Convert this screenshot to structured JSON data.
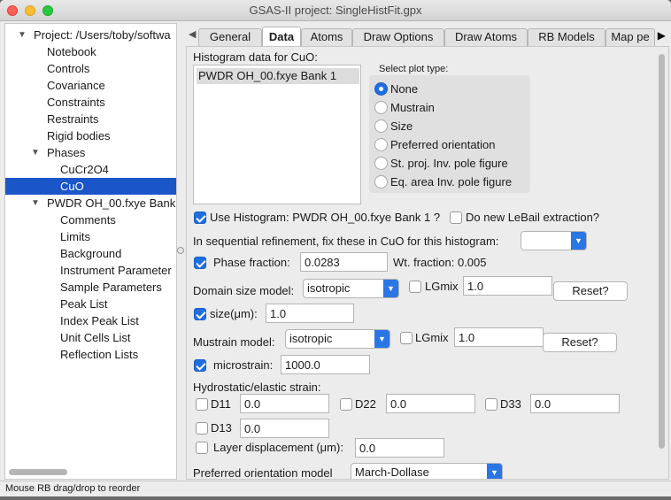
{
  "window": {
    "title": "GSAS-II project: SingleHistFit.gpx"
  },
  "tree": {
    "items": [
      {
        "label": "Project: /Users/toby/softwa",
        "level": 0,
        "arrow": "▼"
      },
      {
        "label": "Notebook",
        "level": 1
      },
      {
        "label": "Controls",
        "level": 1
      },
      {
        "label": "Covariance",
        "level": 1
      },
      {
        "label": "Constraints",
        "level": 1
      },
      {
        "label": "Restraints",
        "level": 1
      },
      {
        "label": "Rigid bodies",
        "level": 1
      },
      {
        "label": "Phases",
        "level": 1,
        "arrow": "▼"
      },
      {
        "label": "CuCr2O4",
        "level": 2
      },
      {
        "label": "CuO",
        "level": 2,
        "selected": true
      },
      {
        "label": "PWDR OH_00.fxye Bank",
        "level": 1,
        "arrow": "▼"
      },
      {
        "label": "Comments",
        "level": 2
      },
      {
        "label": "Limits",
        "level": 2
      },
      {
        "label": "Background",
        "level": 2
      },
      {
        "label": "Instrument Parameter",
        "level": 2
      },
      {
        "label": "Sample Parameters",
        "level": 2
      },
      {
        "label": "Peak List",
        "level": 2
      },
      {
        "label": "Index Peak List",
        "level": 2
      },
      {
        "label": "Unit Cells List",
        "level": 2
      },
      {
        "label": "Reflection Lists",
        "level": 2
      }
    ]
  },
  "tabs": {
    "items": [
      "General",
      "Data",
      "Atoms",
      "Draw Options",
      "Draw Atoms",
      "RB Models",
      "Map pe"
    ],
    "active": "Data"
  },
  "data_tab": {
    "histogram_header": "Histogram data for CuO:",
    "histogram_list": [
      "PWDR OH_00.fxye Bank 1"
    ],
    "plot_type_label": "Select plot type:",
    "plot_types": [
      "None",
      "Mustrain",
      "Size",
      "Preferred orientation",
      "St. proj. Inv. pole figure",
      "Eq. area Inv. pole figure"
    ],
    "plot_type_selected": "None",
    "use_histogram_label": "Use Histogram: PWDR OH_00.fxye Bank 1 ?",
    "use_histogram_checked": true,
    "lebail_label": "Do new LeBail extraction?",
    "lebail_checked": false,
    "seq_fix_label": "In sequential refinement, fix these in CuO for this histogram:",
    "seq_fix_value": "",
    "phase_fraction_label": "Phase fraction:",
    "phase_fraction_checked": true,
    "phase_fraction_value": "0.0283",
    "wt_fraction_label": "Wt. fraction: 0.005",
    "domain_size_model_label": "Domain size model:",
    "domain_size_model_value": "isotropic",
    "size_lgmix_label": "LGmix",
    "size_lgmix_checked": false,
    "size_lgmix_value": "1.0",
    "size_reset_label": "Reset?",
    "size_label": "size(μm):",
    "size_checked": true,
    "size_value": "1.0",
    "mustrain_model_label": "Mustrain model:",
    "mustrain_model_value": "isotropic",
    "mustrain_lgmix_label": "LGmix",
    "mustrain_lgmix_checked": false,
    "mustrain_lgmix_value": "1.0",
    "mustrain_reset_label": "Reset?",
    "microstrain_label": "microstrain:",
    "microstrain_checked": true,
    "microstrain_value": "1000.0",
    "hydrostatic_label": "Hydrostatic/elastic strain:",
    "d11_label": "D11",
    "d11_value": "0.0",
    "d22_label": "D22",
    "d22_value": "0.0",
    "d33_label": "D33",
    "d33_value": "0.0",
    "d13_label": "D13",
    "d13_value": "0.0",
    "layer_disp_label": "Layer displacement (μm):",
    "layer_disp_value": "0.0",
    "pref_orient_label": "Preferred orientation model",
    "pref_orient_value": "March-Dollase"
  },
  "status": {
    "text": "Mouse RB drag/drop to reorder"
  },
  "colors": {
    "accent": "#1f6fe0",
    "tree_selection": "#1a56c8"
  }
}
